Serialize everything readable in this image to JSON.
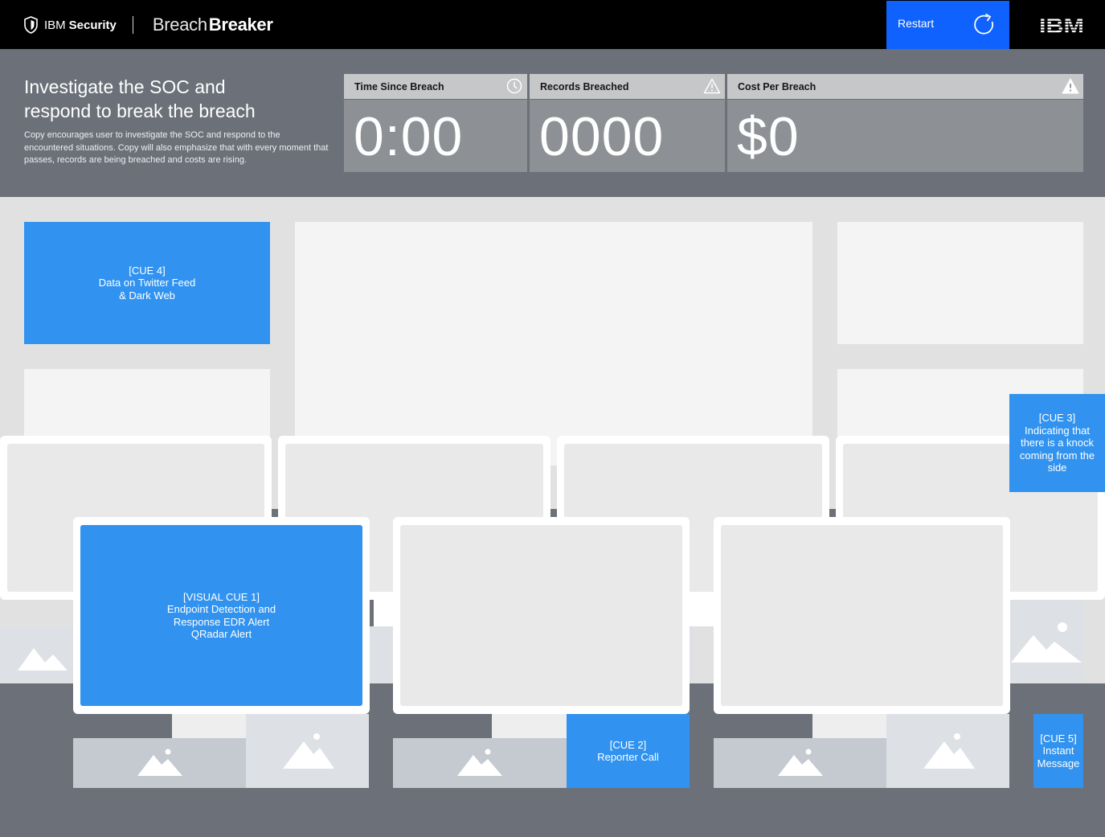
{
  "topbar": {
    "brand_ibm": "IBM",
    "brand_security": "Security",
    "product_light": "Breach",
    "product_bold": "Breaker",
    "restart_label": "Restart",
    "logo": "IBM"
  },
  "header": {
    "headline_line1": "Investigate the SOC and",
    "headline_line2": "respond to break the breach",
    "copy": "Copy encourages user to investigate the SOC and respond to the encountered situations. Copy will also emphasize that with every moment that passes, records are being breached and costs are rising.",
    "stats": [
      {
        "label": "Time Since Breach",
        "value": "0:00",
        "icon": "clock-icon"
      },
      {
        "label": "Records Breached",
        "value": "0000",
        "icon": "warning-outline-icon"
      },
      {
        "label": "Cost Per Breach",
        "value": "$0",
        "icon": "warning-filled-icon"
      }
    ]
  },
  "cues": {
    "cue4": [
      "[CUE 4]",
      "Data on Twitter Feed",
      "& Dark Web"
    ],
    "cue3": [
      "[CUE 3]",
      "Indicating that",
      "there is a knock",
      "coming from the",
      "side"
    ],
    "cue1": [
      "[VISUAL CUE 1]",
      "Endpoint Detection and",
      "Response EDR Alert",
      "QRadar Alert"
    ],
    "cue2": [
      "[CUE 2]",
      "Reporter Call"
    ],
    "cue5": [
      "[CUE 5]",
      "Instant",
      "Message"
    ]
  },
  "colors": {
    "accent_blue": "#0f62fe",
    "cue_blue": "#3193ef",
    "background_gray": "#6b7079",
    "wall_gray": "#e1e1e1"
  }
}
